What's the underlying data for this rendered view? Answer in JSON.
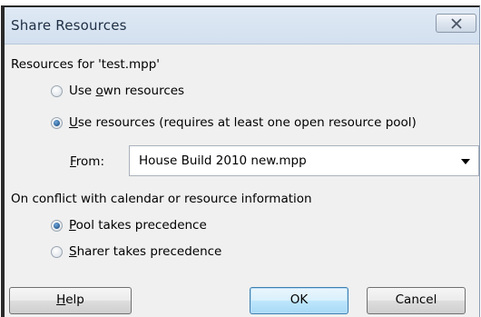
{
  "window": {
    "title": "Share Resources",
    "close_label": "✕"
  },
  "resources_group": {
    "label": "Resources for 'test.mpp'",
    "options": [
      {
        "label_prefix": "Use ",
        "label_mnemonic": "o",
        "label_rest": "wn resources",
        "checked": false
      },
      {
        "label_prefix": "",
        "label_mnemonic": "U",
        "label_rest": "se resources (requires at least one open resource pool)",
        "checked": true
      }
    ],
    "from": {
      "label_mnemonic": "F",
      "label_rest": "rom:",
      "selected_value": "House Build 2010 new.mpp"
    }
  },
  "conflict_group": {
    "label": "On conflict with calendar or resource information",
    "options": [
      {
        "label_prefix": "",
        "label_mnemonic": "P",
        "label_rest": "ool takes precedence",
        "checked": true
      },
      {
        "label_prefix": "",
        "label_mnemonic": "S",
        "label_rest": "harer takes precedence",
        "checked": false
      }
    ]
  },
  "buttons": {
    "help": {
      "mnemonic": "H",
      "rest": "elp"
    },
    "ok": "OK",
    "cancel": "Cancel"
  }
}
